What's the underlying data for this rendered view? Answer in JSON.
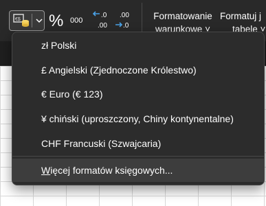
{
  "ribbon": {
    "accounting_button_icon": "accounting-format-icon",
    "accounting_button_chevron": "chevron-down-icon",
    "percent_label": "%",
    "thousands_label": "000",
    "increase_decimal_top": ".0",
    "increase_decimal_bottom": ".00",
    "decrease_decimal_top": ".00",
    "decrease_decimal_bottom": ".0",
    "conditional_formatting_line1": "Formatowanie",
    "conditional_formatting_line2": "warunkowe ˅",
    "format_as_table_line1": "Formatuj j",
    "format_as_table_line2": "tabele ˅"
  },
  "menu": {
    "items": [
      {
        "label": "zł Polski"
      },
      {
        "label": "£ Angielski (Zjednoczone Królestwo)"
      },
      {
        "label": "€ Euro (€ 123)"
      },
      {
        "label": "¥ chiński (uproszczony, Chiny kontynentalne)"
      },
      {
        "label": "CHF Francuski (Szwajcaria)"
      }
    ],
    "more_first_letter": "W",
    "more_rest": "ięcej formatów księgowych..."
  },
  "colors": {
    "ribbon_bg": "#292929",
    "menu_bg": "#2c2c2c",
    "menu_hover": "#3d3d3d",
    "text": "#ffffff",
    "arrow_accent": "#4aa3e8"
  }
}
